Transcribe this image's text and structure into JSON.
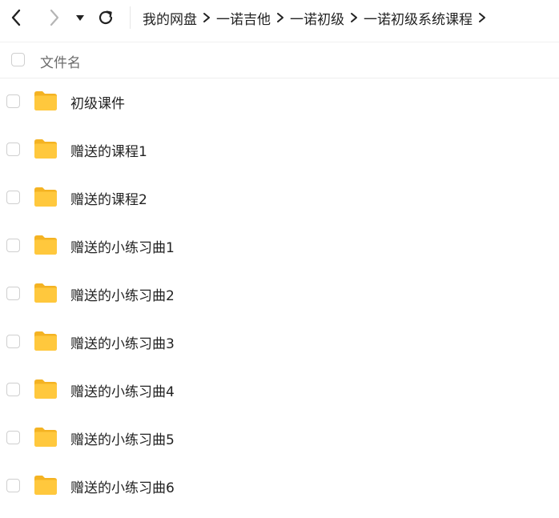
{
  "toolbar": {
    "back": "chevron-left-icon",
    "forward": "chevron-right-icon",
    "history": "caret-down-icon",
    "refresh": "refresh-icon"
  },
  "breadcrumb": [
    "我的网盘",
    "一诺吉他",
    "一诺初级",
    "一诺初级系统课程"
  ],
  "header": {
    "name_label": "文件名"
  },
  "files": [
    {
      "name": "初级课件"
    },
    {
      "name": "赠送的课程1"
    },
    {
      "name": "赠送的课程2"
    },
    {
      "name": "赠送的小练习曲1"
    },
    {
      "name": "赠送的小练习曲2"
    },
    {
      "name": "赠送的小练习曲3"
    },
    {
      "name": "赠送的小练习曲4"
    },
    {
      "name": "赠送的小练习曲5"
    },
    {
      "name": "赠送的小练习曲6"
    }
  ],
  "colors": {
    "folder": "#FFC83D",
    "folder_dark": "#F4B323",
    "text": "#222222"
  }
}
